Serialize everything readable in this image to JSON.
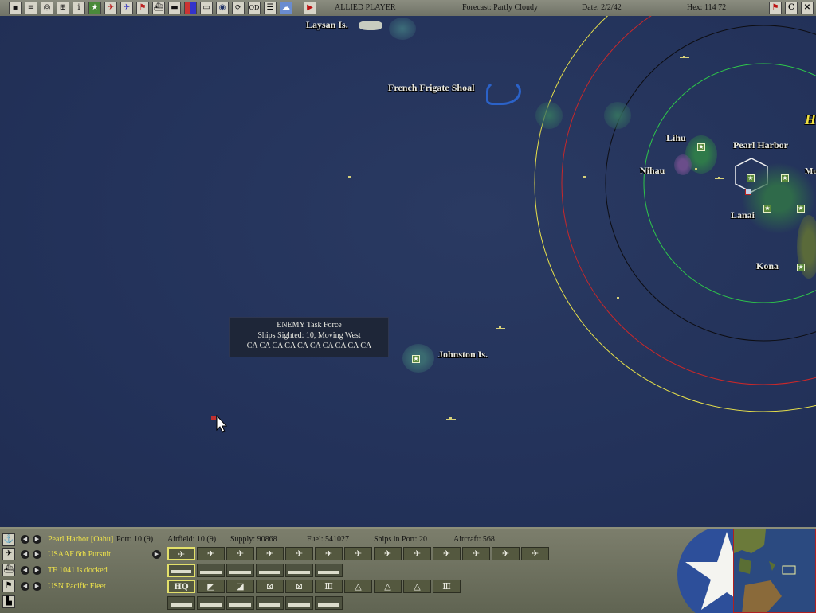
{
  "toolbar": {
    "player": "ALLIED PLAYER",
    "forecast": "Forecast: Partly Cloudy",
    "date": "Date: 2/2/42",
    "hex": "Hex: 114  72",
    "buttons": [
      "save",
      "load",
      "replay",
      "options",
      "info",
      "airbase",
      "air-group",
      "air-unit",
      "flag",
      "ship",
      "mixed",
      "transport",
      "globe",
      "refresh",
      "od",
      "list",
      "clouds",
      "end-turn"
    ],
    "right_buttons": [
      "c-button",
      "exit-button"
    ],
    "end_turn_glyph": "▶"
  },
  "map": {
    "places": {
      "laysan": "Laysan Is.",
      "french_frigate": "French Frigate Shoal",
      "lihu": "Lihu",
      "nihau": "Nihau",
      "pearl_harbor": "Pearl Harbor",
      "lanai": "Lanai",
      "kona": "Kona",
      "johnston": "Johnston Is.",
      "mo": "Mo",
      "h": "H"
    },
    "enemy_tf": {
      "title": "ENEMY Task Force",
      "sighted": "Ships Sighted: 10,  Moving West",
      "ships": "CA CA CA CA CA CA CA CA CA CA"
    },
    "colors": {
      "yellow_ring": "#e8e14a",
      "red_ring": "#c8282a",
      "black_ring": "#0d0d12",
      "green_ring": "#2ec84a",
      "ocean": "#24335b"
    }
  },
  "bottom": {
    "base": "Pearl Harbor [Oahu]",
    "port": "Port: 10 (9)",
    "airfield": "Airfield: 10 (9)",
    "supply": "Supply: 90868",
    "fuel": "Fuel: 541027",
    "ships_in_port": "Ships in Port: 20",
    "aircraft": "Aircraft: 568",
    "air_unit": "USAAF 6th Pursuit",
    "task_force": "TF 1041 is docked",
    "command": "USN Pacific Fleet",
    "hq_label": "HQ",
    "left_arrow": "◀",
    "right_arrow": "▶"
  }
}
